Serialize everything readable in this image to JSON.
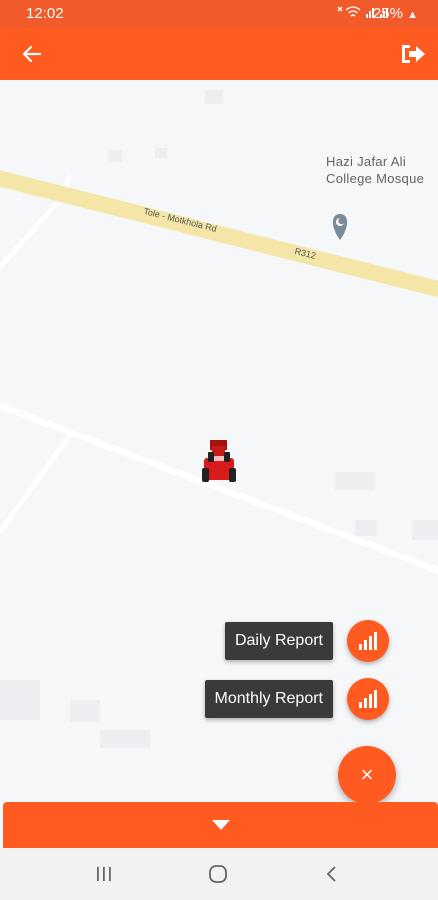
{
  "status_bar": {
    "time": "12:02",
    "battery": "25%",
    "color": "#f15a2a"
  },
  "app_bar": {
    "color": "#ff5a1f",
    "back_icon": "arrow-left-icon",
    "logout_icon": "logout-icon"
  },
  "map": {
    "poi": "Hazi Jafar Ali College Mosque",
    "road_label_1": "Tole - Motkhola Rd",
    "road_label_2": "R312",
    "vehicle_icon": "tractor-icon"
  },
  "fab_menu": {
    "daily_report": "Daily Report",
    "monthly_report": "Monthly Report",
    "close_label": "×",
    "fab_icon": "signal-bars-icon"
  },
  "bottom_sheet": {
    "toggle_icon": "caret-down-icon"
  },
  "nav_bar": {
    "recent_icon": "recent-apps-icon",
    "home_icon": "home-icon",
    "back_icon": "back-icon"
  }
}
